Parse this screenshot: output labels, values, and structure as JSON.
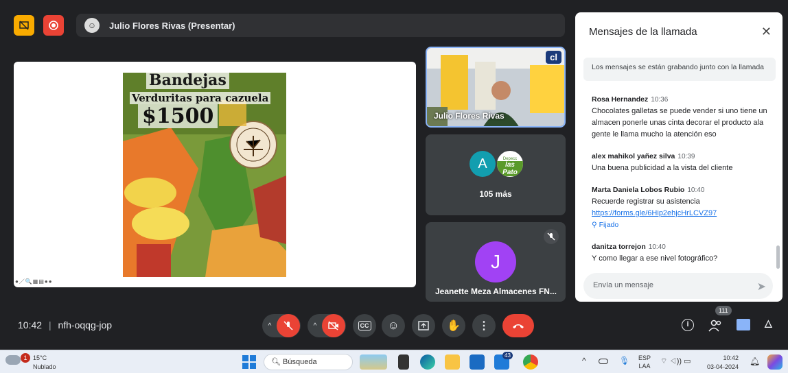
{
  "presenter": {
    "name": "Julio Flores Rivas (Presentar)"
  },
  "slide": {
    "title": "Bandejas",
    "subtitle": "Verduritas para cazuela",
    "price": "$1500"
  },
  "tiles": {
    "self_name": "Julio Flores Rivas",
    "self_logo": "cl",
    "more_avatar_letter": "A",
    "more_logo_line1": "Depecc",
    "more_logo_line2": "las Pato",
    "more_label": "105 más",
    "j_letter": "J",
    "j_name": "Jeanette Meza Almacenes FN..."
  },
  "chat": {
    "title": "Mensajes de la llamada",
    "recording_note": "Los mensajes se están grabando junto con la llamada",
    "messages": [
      {
        "author": "Rosa Hernandez",
        "time": "10:36",
        "text": "Chocolates galletas se puede vender si uno tiene un almacen ponerle unas cinta decorar el producto ala gente le llama mucho la atención eso"
      },
      {
        "author": "alex mahikol yañez silva",
        "time": "10:39",
        "text": "Una buena publicidad a la vista del cliente"
      },
      {
        "author": "Marta Daniela Lobos Rubio",
        "time": "10:40",
        "text": "Recuerde registrar su asistencia",
        "link": "https://forms.gle/6Hip2ehjcHrLCVZ97",
        "pinned": "Fijado"
      },
      {
        "author": "danitza torrejon",
        "time": "10:40",
        "text": "Y como llegar a ese nivel fotográfico?"
      }
    ],
    "input_placeholder": "Envía un mensaje"
  },
  "meeting": {
    "time": "10:42",
    "separator": "|",
    "code": "nfh-oqqg-jop",
    "participants_count": "111"
  },
  "taskbar": {
    "weather_temp": "15°C",
    "weather_desc": "Nublado",
    "weather_badge": "1",
    "search_placeholder": "Búsqueda",
    "mail_badge": "43",
    "lang1": "ESP",
    "lang2": "LAA",
    "clock_time": "10:42",
    "clock_date": "03-04-2024"
  },
  "colors": {
    "accent": "#1a73e8",
    "danger": "#ea4335",
    "panel": "#3c4043",
    "bg": "#202124"
  }
}
